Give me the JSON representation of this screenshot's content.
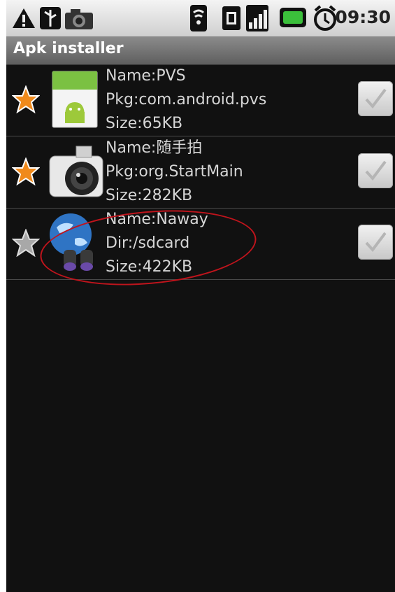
{
  "status_bar": {
    "time": "09:30",
    "icons": [
      "warning-icon",
      "usb-icon",
      "camera-icon",
      "wifi-icon",
      "sim-icon",
      "signal-icon",
      "battery-icon",
      "alarm-icon"
    ]
  },
  "app": {
    "title": "Apk installer"
  },
  "apps": [
    {
      "icon": "android-icon",
      "favorite": true,
      "name": "Name:PVS",
      "detail": "Pkg:com.android.pvs",
      "size": "Size:65KB",
      "checked": true
    },
    {
      "icon": "camera-icon",
      "favorite": true,
      "name": "Name:随手拍",
      "detail": "Pkg:org.StartMain",
      "size": "Size:282KB",
      "checked": true
    },
    {
      "icon": "globe-binoculars-icon",
      "favorite": false,
      "name": "Name:Naway",
      "detail": "Dir:/sdcard",
      "size": "Size:422KB",
      "checked": true
    }
  ],
  "colors": {
    "background": "#111111",
    "title_bar": "#6f6f6f",
    "star_active": "#f08a1c",
    "star_inactive": "#a8a8a8",
    "annotation": "#c0141c"
  }
}
